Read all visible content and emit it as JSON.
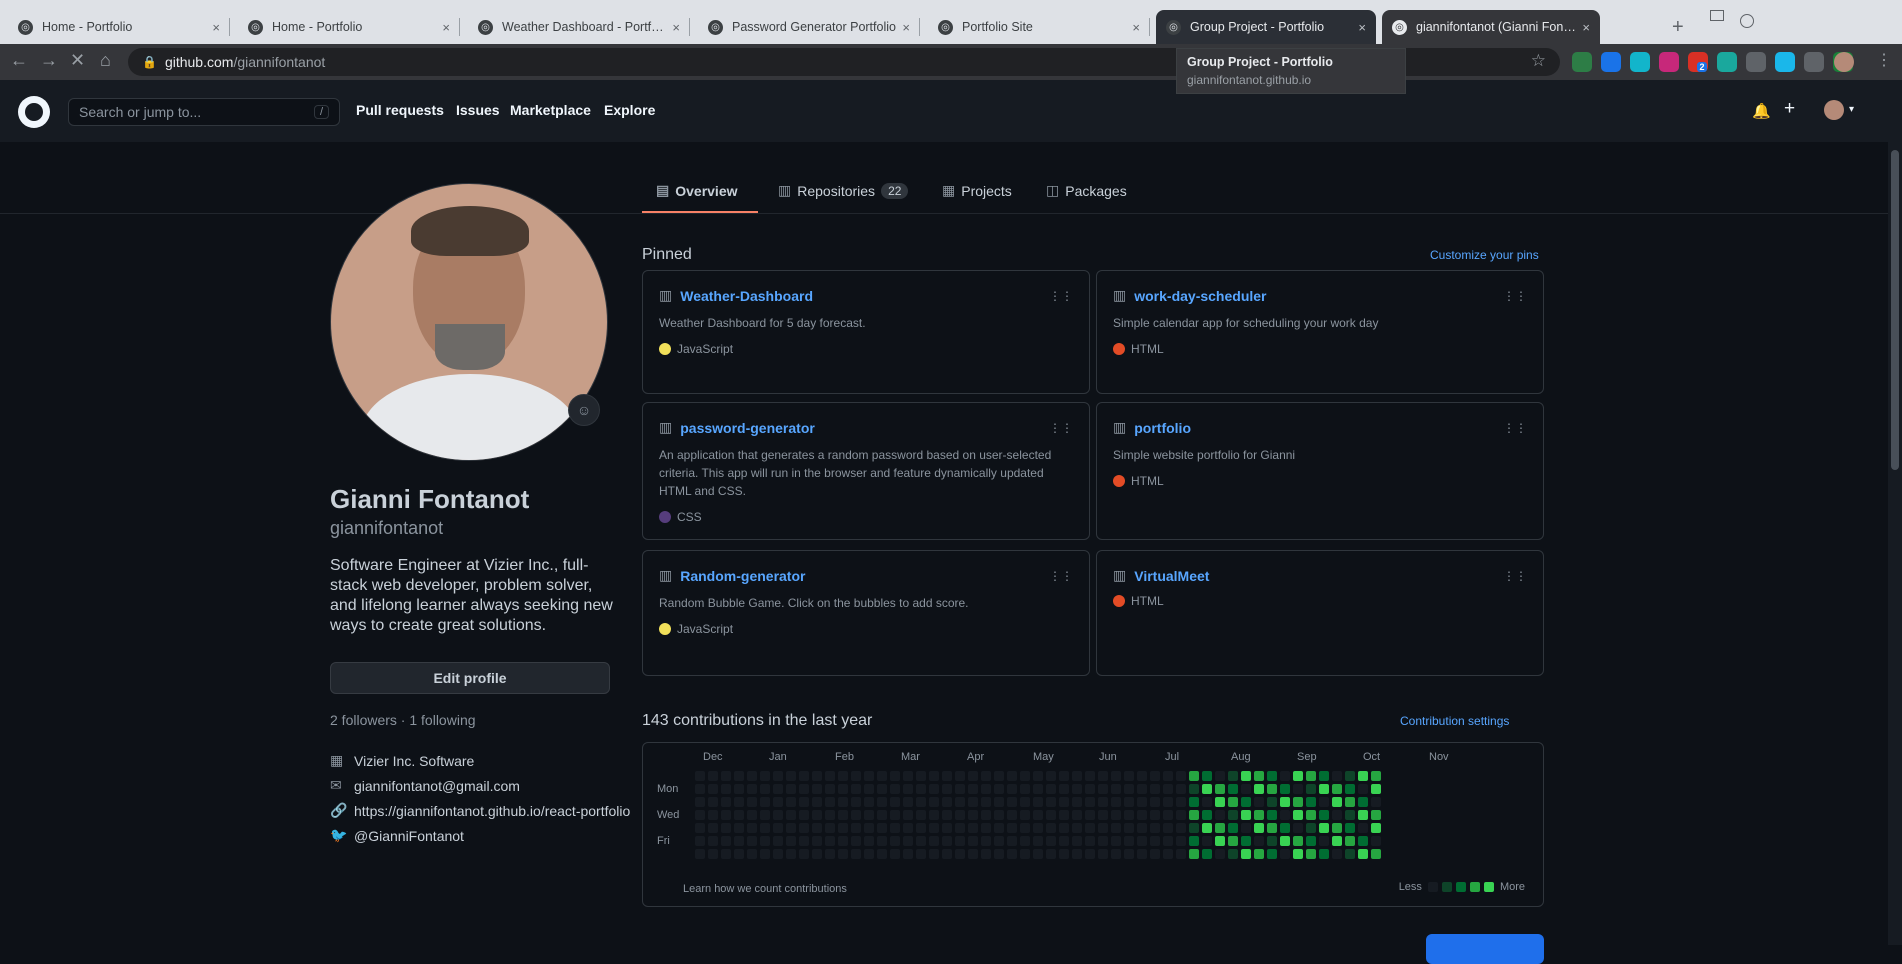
{
  "browser": {
    "tabs": [
      {
        "title": "Home - Portfolio",
        "state": "normal"
      },
      {
        "title": "Home - Portfolio",
        "state": "normal"
      },
      {
        "title": "Weather Dashboard - Portfolio",
        "state": "normal"
      },
      {
        "title": "Password Generator Portfolio",
        "state": "normal"
      },
      {
        "title": "Portfolio Site",
        "state": "normal"
      },
      {
        "title": "Group Project - Portfolio",
        "state": "hover"
      },
      {
        "title": "giannifontanot (Gianni Fontanot)",
        "state": "active"
      }
    ],
    "close_glyph": "×",
    "new_tab_glyph": "+",
    "address": {
      "domain": "github.com",
      "path": "/giannifontanot"
    },
    "tooltip": {
      "title": "Group Project - Portfolio",
      "url": "giannifontanot.github.io"
    },
    "extensions": [
      {
        "name": "office-icon",
        "color": "#2d7d46"
      },
      {
        "name": "pin-icon",
        "color": "#1a73e8"
      },
      {
        "name": "globe-icon",
        "color": "#12b5cb"
      },
      {
        "name": "lightning-icon",
        "color": "#c7287a"
      },
      {
        "name": "badge-icon",
        "color": "#d93025",
        "badge": "2"
      },
      {
        "name": "eye-icon",
        "color": "#1aa89d"
      },
      {
        "name": "glasses-icon",
        "color": "#5f6368"
      },
      {
        "name": "vimeo-icon",
        "color": "#1ab7ea"
      },
      {
        "name": "puzzle-icon",
        "color": "#5f6368"
      },
      {
        "name": "leaf-icon",
        "color": "#188038"
      }
    ]
  },
  "github": {
    "search_placeholder": "Search or jump to...",
    "search_shortcut": "/",
    "nav": [
      "Pull requests",
      "Issues",
      "Marketplace",
      "Explore"
    ]
  },
  "profile": {
    "tabs": [
      {
        "label": "Overview",
        "icon": "book-icon",
        "count": null
      },
      {
        "label": "Repositories",
        "icon": "repo-icon",
        "count": "22"
      },
      {
        "label": "Projects",
        "icon": "project-icon",
        "count": null
      },
      {
        "label": "Packages",
        "icon": "package-icon",
        "count": null
      }
    ],
    "name": "Gianni Fontanot",
    "login": "giannifontanot",
    "bio": "Software Engineer at Vizier Inc., full-stack web developer, problem solver, and lifelong learner always seeking new ways to create great solutions.",
    "edit_button": "Edit profile",
    "followers_line": "2 followers · 1 following",
    "vcard": [
      {
        "icon": "organization-icon",
        "text": "Vizier Inc. Software"
      },
      {
        "icon": "mail-icon",
        "text": "giannifontanot@gmail.com"
      },
      {
        "icon": "link-icon",
        "text": "https://giannifontanot.github.io/react-portfolio"
      },
      {
        "icon": "twitter-icon",
        "text": "@GianniFontanot"
      }
    ]
  },
  "pinned": {
    "title": "Pinned",
    "customize": "Customize your pins",
    "repos": [
      {
        "name": "Weather-Dashboard",
        "desc": "Weather Dashboard for 5 day forecast.",
        "lang": "JavaScript",
        "color": "#f1e05a"
      },
      {
        "name": "work-day-scheduler",
        "desc": "Simple calendar app for scheduling your work day",
        "lang": "HTML",
        "color": "#e34c26"
      },
      {
        "name": "password-generator",
        "desc": "An application that generates a random password based on user-selected criteria. This app will run in the browser and feature dynamically updated HTML and CSS.",
        "lang": "CSS",
        "color": "#563d7c"
      },
      {
        "name": "portfolio",
        "desc": "Simple website portfolio for Gianni",
        "lang": "HTML",
        "color": "#e34c26"
      },
      {
        "name": "Random-generator",
        "desc": "Random Bubble Game. Click on the bubbles to add score.",
        "lang": "JavaScript",
        "color": "#f1e05a"
      },
      {
        "name": "VirtualMeet",
        "desc": "",
        "lang": "HTML",
        "color": "#e34c26"
      }
    ]
  },
  "contributions": {
    "title": "143 contributions in the last year",
    "settings": "Contribution settings",
    "months": [
      "Dec",
      "Jan",
      "Feb",
      "Mar",
      "Apr",
      "May",
      "Jun",
      "Jul",
      "Aug",
      "Sep",
      "Oct",
      "Nov"
    ],
    "weekdays": [
      "Mon",
      "Wed",
      "Fri"
    ],
    "learn": "Learn how we count contributions",
    "legend_less": "Less",
    "legend_more": "More",
    "levels": [
      "#161b22",
      "#0e4429",
      "#006d32",
      "#26a641",
      "#39d353"
    ]
  }
}
